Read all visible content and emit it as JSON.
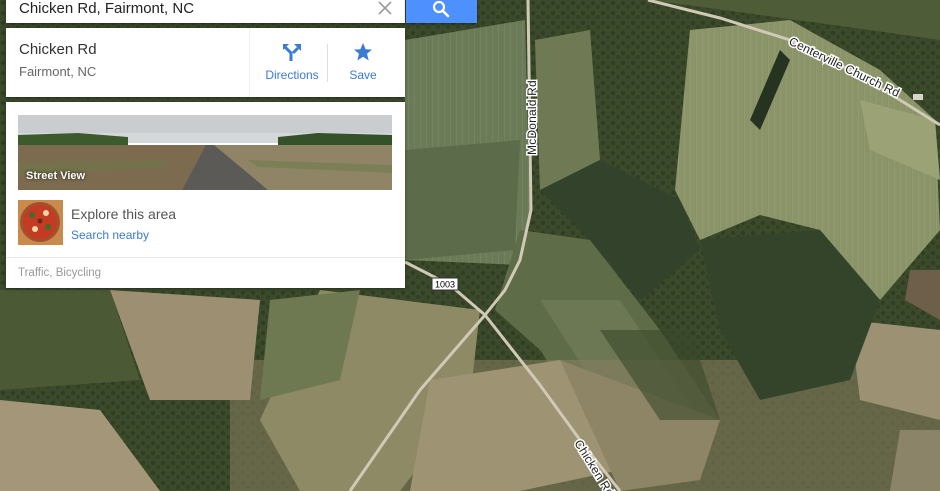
{
  "search": {
    "value": "Chicken Rd, Fairmont, NC",
    "clear_icon": "close-icon",
    "button_icon": "search-icon",
    "button_color": "#4d90fe"
  },
  "place": {
    "title": "Chicken Rd",
    "subtitle": "Fairmont, NC",
    "directions_label": "Directions",
    "directions_icon": "directions-icon",
    "save_label": "Save",
    "save_icon": "star-icon",
    "accent_color": "#3a7bd5"
  },
  "explore": {
    "street_view_label": "Street View",
    "title": "Explore this area",
    "link": "Search nearby",
    "layers_line": "Traffic, Bicycling"
  },
  "map": {
    "view": "satellite",
    "road_labels": {
      "mcdonald": "McDonald Rd",
      "centerville": "Centerville Church Rd",
      "chicken": "Chicken Rd",
      "route_shield": "1003"
    }
  }
}
